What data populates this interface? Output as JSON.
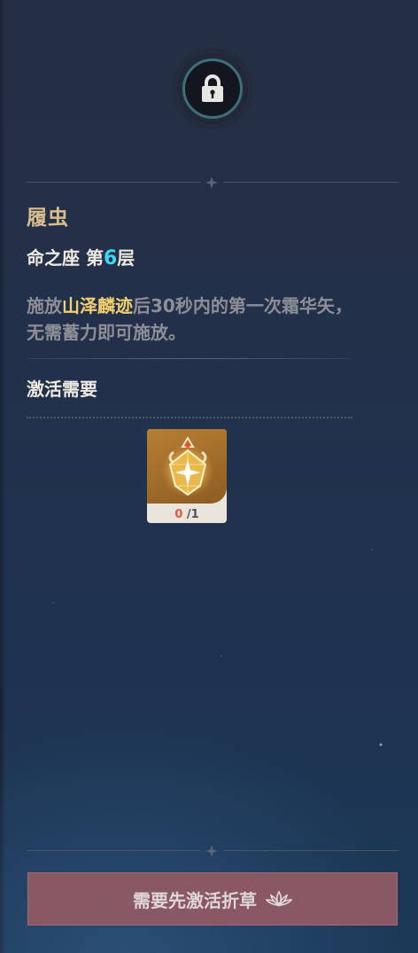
{
  "constellation": {
    "name": "履虫",
    "level_prefix": "命之座 第",
    "level_number": "6",
    "level_suffix": "层",
    "description_before": "施放",
    "description_highlight": "山泽麟迹",
    "description_after": "后30秒内的第一次霜华矢，无需蓄力即可施放。",
    "locked": true
  },
  "requirements": {
    "heading": "激活需要",
    "items": [
      {
        "icon": "constellation-gem-icon",
        "current": "0",
        "separator": "/",
        "required": "1"
      }
    ]
  },
  "action": {
    "label": "需要先激活折草",
    "icon": "lotus-icon",
    "disabled": true
  },
  "colors": {
    "title": "#d7bd8d",
    "highlight": "#f2d06e",
    "level_number": "#3fd6f0",
    "count_current": "#e3563c",
    "button_bg": "#8f5a63"
  }
}
